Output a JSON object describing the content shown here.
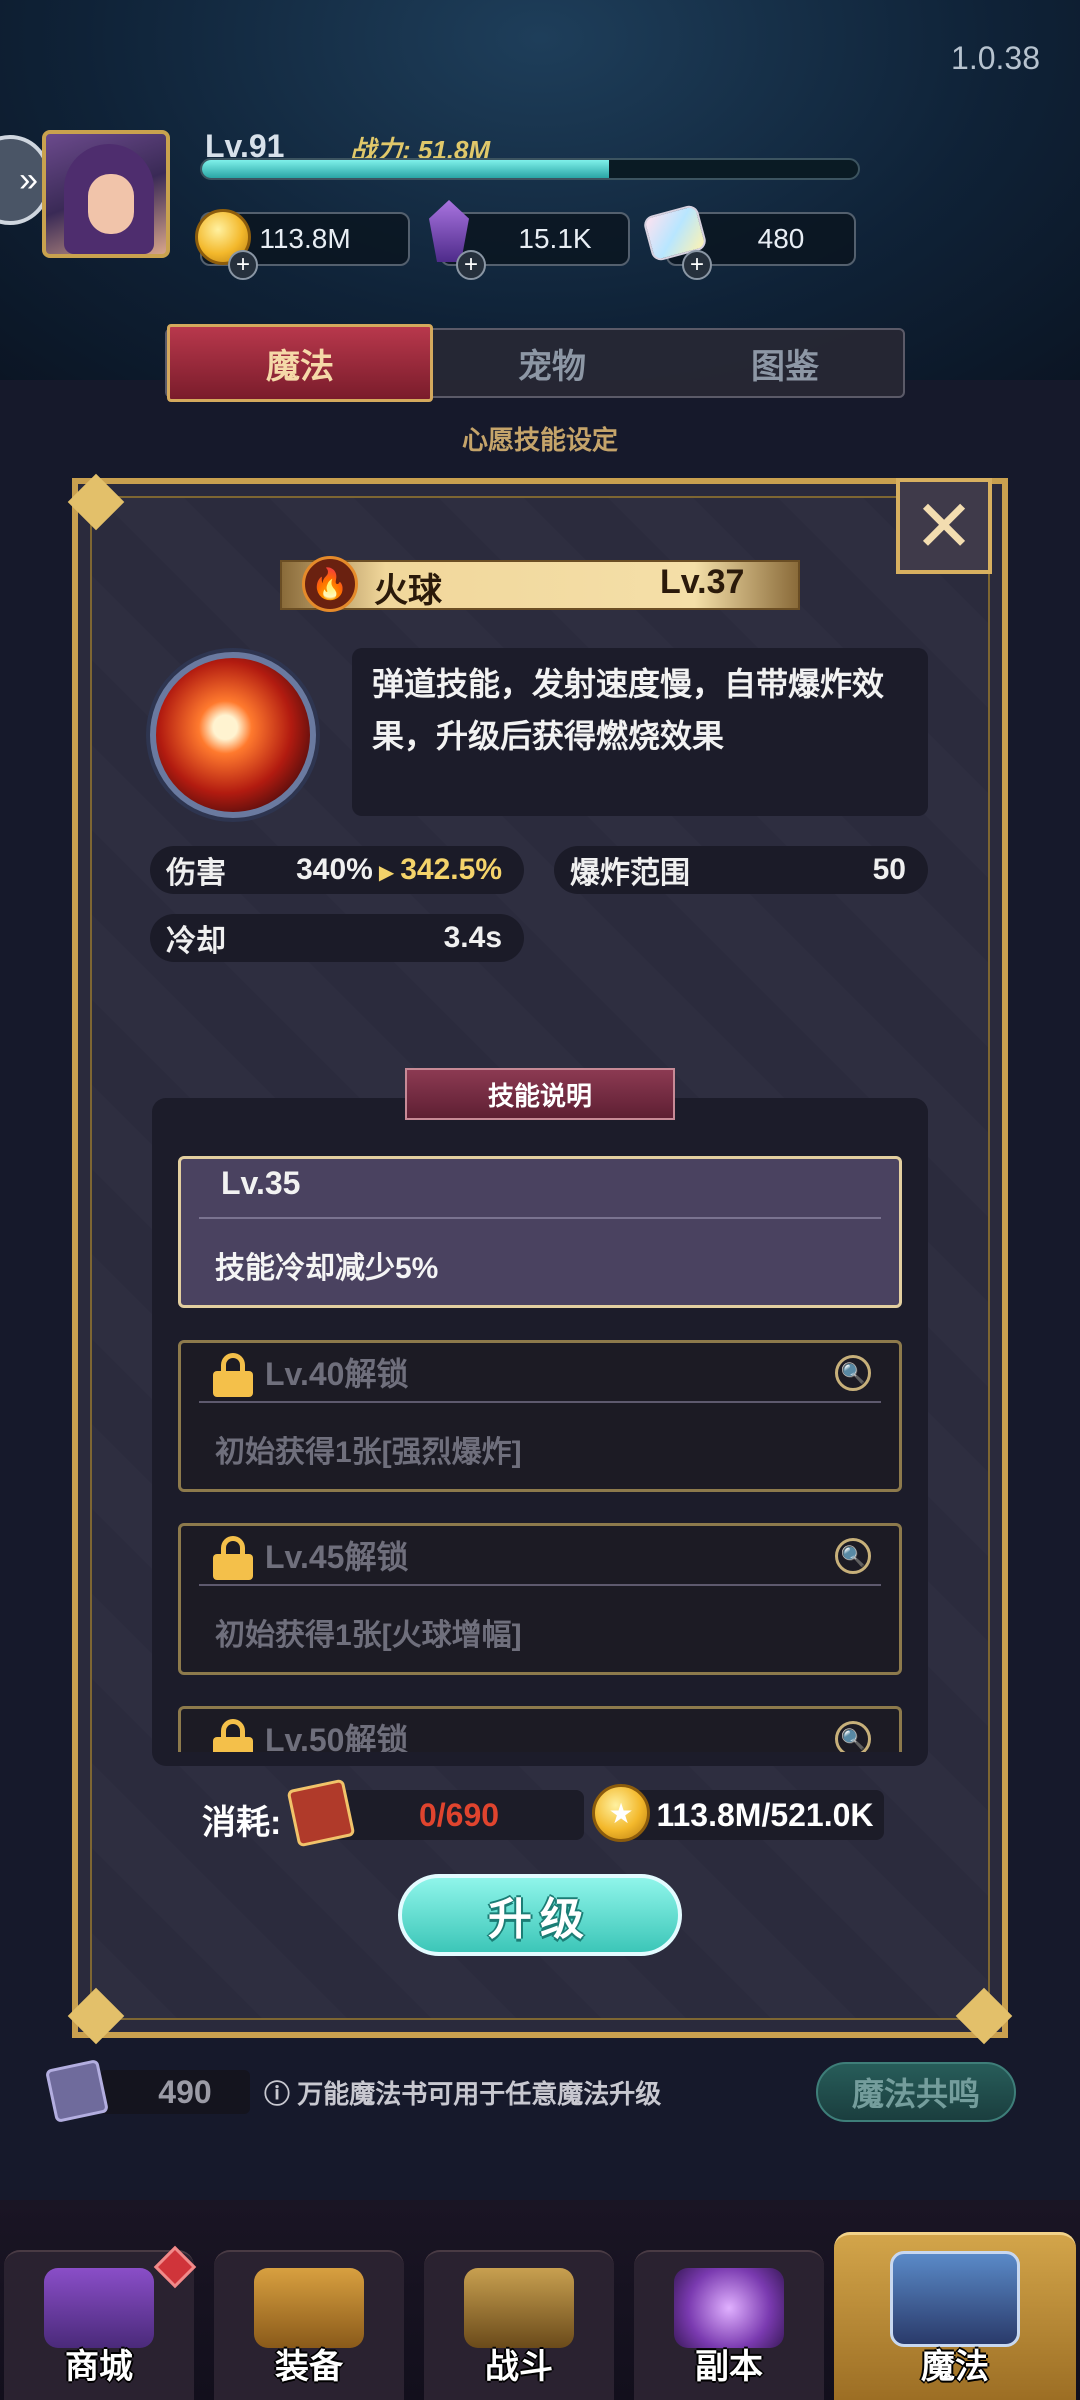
{
  "version": "1.0.38",
  "player": {
    "level": "Lv.91",
    "power": "战力: 51.8M",
    "exp_progress": 0.62
  },
  "resources": [
    {
      "icon": "gold-coin-icon",
      "value": "113.8M"
    },
    {
      "icon": "purple-crystal-icon",
      "value": "15.1K"
    },
    {
      "icon": "rainbow-gem-icon",
      "value": "480"
    }
  ],
  "tabs": [
    {
      "label": "魔法",
      "active": true
    },
    {
      "label": "宠物",
      "active": false
    },
    {
      "label": "图鉴",
      "active": false
    }
  ],
  "wish_title": "心愿技能设定",
  "skill": {
    "name": "火球",
    "level": "Lv.37",
    "description": "弹道技能，发射速度慢，自带爆炸效果，升级后获得燃烧效果",
    "stats": {
      "damage_label": "伤害",
      "damage_current": "340%",
      "damage_next": "342.5%",
      "explosion_label": "爆炸范围",
      "explosion_value": "50",
      "cooldown_label": "冷却",
      "cooldown_value": "3.4s"
    }
  },
  "explanation": {
    "title": "技能说明",
    "levels": [
      {
        "title": "Lv.35",
        "text": "技能冷却减少5%",
        "unlocked": true
      },
      {
        "title": "Lv.40解锁",
        "text": "初始获得1张[强烈爆炸]",
        "unlocked": false
      },
      {
        "title": "Lv.45解锁",
        "text": "初始获得1张[火球增幅]",
        "unlocked": false
      },
      {
        "title": "Lv.50解锁",
        "text": "",
        "unlocked": false
      }
    ]
  },
  "cost": {
    "label": "消耗:",
    "books": "0/690",
    "gold": "113.8M/521.0K"
  },
  "upgrade_label": "升级",
  "universal": {
    "count": "490",
    "note": "万能魔法书可用于任意魔法升级",
    "resonance_label": "魔法共鸣"
  },
  "nav": [
    {
      "label": "商城",
      "icon": "shop-icon"
    },
    {
      "label": "装备",
      "icon": "chest-icon"
    },
    {
      "label": "战斗",
      "icon": "battle-icon"
    },
    {
      "label": "副本",
      "icon": "dungeon-icon"
    },
    {
      "label": "魔法",
      "icon": "spellbook-icon",
      "active": true
    }
  ],
  "colors": {
    "accent_gold": "#c9a04f",
    "highlight_yellow": "#f4d36a",
    "cost_red": "#e0442e",
    "upgrade_teal": "#3cc6b8"
  }
}
